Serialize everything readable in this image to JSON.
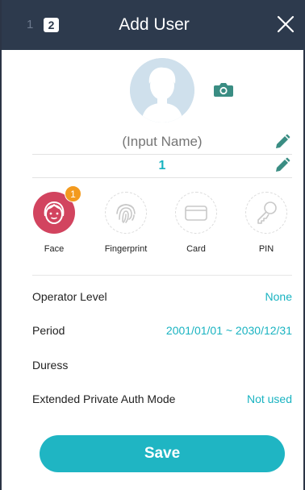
{
  "header": {
    "step_1": "1",
    "step_2": "2",
    "title": "Add User"
  },
  "user": {
    "name_placeholder": "(Input Name)",
    "id_value": "1"
  },
  "auth_methods": [
    {
      "label": "Face",
      "count": "1",
      "active": true
    },
    {
      "label": "Fingerprint",
      "active": false
    },
    {
      "label": "Card",
      "active": false
    },
    {
      "label": "PIN",
      "active": false
    }
  ],
  "settings": {
    "operator_level": {
      "label": "Operator Level",
      "value": "None"
    },
    "period": {
      "label": "Period",
      "value": "2001/01/01 ~ 2030/12/31"
    },
    "duress": {
      "label": "Duress",
      "value": ""
    },
    "extended_auth": {
      "label": "Extended Private Auth Mode",
      "value": "Not used"
    }
  },
  "actions": {
    "save_label": "Save"
  },
  "colors": {
    "header_bg": "#2d3a4d",
    "accent": "#1fb5c3",
    "face_active": "#d2445f",
    "badge": "#f39a1e",
    "avatar_bg": "#cfe0ec"
  },
  "icons": [
    "close-icon",
    "avatar-icon",
    "camera-icon",
    "pencil-icon",
    "face-icon",
    "fingerprint-icon",
    "card-icon",
    "key-icon"
  ]
}
